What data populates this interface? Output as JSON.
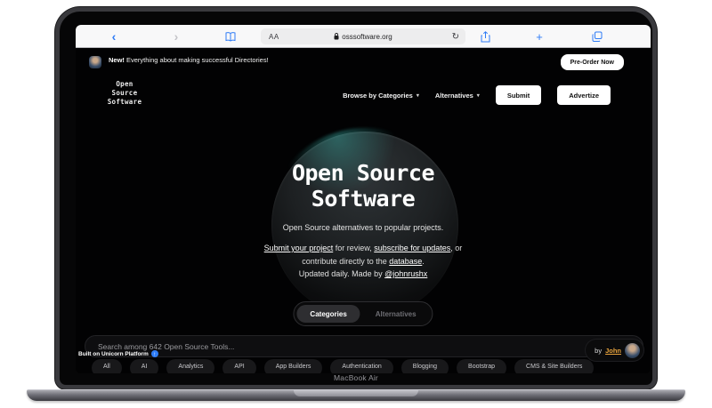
{
  "browser": {
    "url": "osssoftware.org",
    "reader_button": "AA",
    "back_glyph": "‹",
    "forward_glyph": "›",
    "reload_glyph": "↻",
    "new_tab_glyph": "+"
  },
  "announcement": {
    "badge": "New!",
    "message": " Everything about making successful Directories!",
    "cta": "Pre-Order Now"
  },
  "nav": {
    "logo_line1": "Open",
    "logo_line2": "Source",
    "logo_line3": "Software",
    "browse_label": "Browse by Categories",
    "alternatives_label": "Alternatives",
    "caret": "▾",
    "submit_label": "Submit",
    "advertize_label": "Advertize"
  },
  "hero": {
    "title_line1": "Open Source",
    "title_line2": "Software",
    "tagline": "Open Source alternatives to popular projects.",
    "cta_link1": "Submit your project",
    "cta_mid1": " for review, ",
    "cta_link2": "subscribe for updates",
    "cta_mid2a": ", or",
    "cta_mid2b": "contribute directly to the ",
    "cta_link3": "database",
    "cta_end": ".",
    "updated_prefix": "Updated daily. Made by ",
    "author_handle": "@johnrushx"
  },
  "toggle": {
    "categories": "Categories",
    "alternatives": "Alternatives"
  },
  "search": {
    "placeholder": "Search among 642 Open Source Tools..."
  },
  "footer": {
    "built_prefix": "Built on ",
    "built_bold": "Unicorn Platform",
    "by_label": "by",
    "by_name": "John"
  },
  "pills": [
    "All",
    "AI",
    "Analytics",
    "API",
    "App Builders",
    "Authentication",
    "Blogging",
    "Bootstrap",
    "CMS & Site Builders"
  ],
  "device": {
    "name": "MacBook Air"
  },
  "colors": {
    "accent_blue": "#2f7cf6",
    "link_orange": "#e8a33d"
  }
}
